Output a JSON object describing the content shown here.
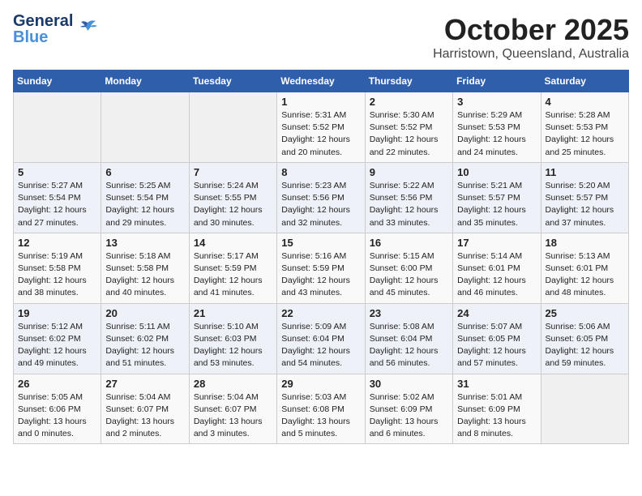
{
  "header": {
    "logo_line1": "General",
    "logo_line2": "Blue",
    "month": "October 2025",
    "location": "Harristown, Queensland, Australia"
  },
  "days_of_week": [
    "Sunday",
    "Monday",
    "Tuesday",
    "Wednesday",
    "Thursday",
    "Friday",
    "Saturday"
  ],
  "weeks": [
    [
      {
        "day": "",
        "info": ""
      },
      {
        "day": "",
        "info": ""
      },
      {
        "day": "",
        "info": ""
      },
      {
        "day": "1",
        "info": "Sunrise: 5:31 AM\nSunset: 5:52 PM\nDaylight: 12 hours and 20 minutes."
      },
      {
        "day": "2",
        "info": "Sunrise: 5:30 AM\nSunset: 5:52 PM\nDaylight: 12 hours and 22 minutes."
      },
      {
        "day": "3",
        "info": "Sunrise: 5:29 AM\nSunset: 5:53 PM\nDaylight: 12 hours and 24 minutes."
      },
      {
        "day": "4",
        "info": "Sunrise: 5:28 AM\nSunset: 5:53 PM\nDaylight: 12 hours and 25 minutes."
      }
    ],
    [
      {
        "day": "5",
        "info": "Sunrise: 5:27 AM\nSunset: 5:54 PM\nDaylight: 12 hours and 27 minutes."
      },
      {
        "day": "6",
        "info": "Sunrise: 5:25 AM\nSunset: 5:54 PM\nDaylight: 12 hours and 29 minutes."
      },
      {
        "day": "7",
        "info": "Sunrise: 5:24 AM\nSunset: 5:55 PM\nDaylight: 12 hours and 30 minutes."
      },
      {
        "day": "8",
        "info": "Sunrise: 5:23 AM\nSunset: 5:56 PM\nDaylight: 12 hours and 32 minutes."
      },
      {
        "day": "9",
        "info": "Sunrise: 5:22 AM\nSunset: 5:56 PM\nDaylight: 12 hours and 33 minutes."
      },
      {
        "day": "10",
        "info": "Sunrise: 5:21 AM\nSunset: 5:57 PM\nDaylight: 12 hours and 35 minutes."
      },
      {
        "day": "11",
        "info": "Sunrise: 5:20 AM\nSunset: 5:57 PM\nDaylight: 12 hours and 37 minutes."
      }
    ],
    [
      {
        "day": "12",
        "info": "Sunrise: 5:19 AM\nSunset: 5:58 PM\nDaylight: 12 hours and 38 minutes."
      },
      {
        "day": "13",
        "info": "Sunrise: 5:18 AM\nSunset: 5:58 PM\nDaylight: 12 hours and 40 minutes."
      },
      {
        "day": "14",
        "info": "Sunrise: 5:17 AM\nSunset: 5:59 PM\nDaylight: 12 hours and 41 minutes."
      },
      {
        "day": "15",
        "info": "Sunrise: 5:16 AM\nSunset: 5:59 PM\nDaylight: 12 hours and 43 minutes."
      },
      {
        "day": "16",
        "info": "Sunrise: 5:15 AM\nSunset: 6:00 PM\nDaylight: 12 hours and 45 minutes."
      },
      {
        "day": "17",
        "info": "Sunrise: 5:14 AM\nSunset: 6:01 PM\nDaylight: 12 hours and 46 minutes."
      },
      {
        "day": "18",
        "info": "Sunrise: 5:13 AM\nSunset: 6:01 PM\nDaylight: 12 hours and 48 minutes."
      }
    ],
    [
      {
        "day": "19",
        "info": "Sunrise: 5:12 AM\nSunset: 6:02 PM\nDaylight: 12 hours and 49 minutes."
      },
      {
        "day": "20",
        "info": "Sunrise: 5:11 AM\nSunset: 6:02 PM\nDaylight: 12 hours and 51 minutes."
      },
      {
        "day": "21",
        "info": "Sunrise: 5:10 AM\nSunset: 6:03 PM\nDaylight: 12 hours and 53 minutes."
      },
      {
        "day": "22",
        "info": "Sunrise: 5:09 AM\nSunset: 6:04 PM\nDaylight: 12 hours and 54 minutes."
      },
      {
        "day": "23",
        "info": "Sunrise: 5:08 AM\nSunset: 6:04 PM\nDaylight: 12 hours and 56 minutes."
      },
      {
        "day": "24",
        "info": "Sunrise: 5:07 AM\nSunset: 6:05 PM\nDaylight: 12 hours and 57 minutes."
      },
      {
        "day": "25",
        "info": "Sunrise: 5:06 AM\nSunset: 6:05 PM\nDaylight: 12 hours and 59 minutes."
      }
    ],
    [
      {
        "day": "26",
        "info": "Sunrise: 5:05 AM\nSunset: 6:06 PM\nDaylight: 13 hours and 0 minutes."
      },
      {
        "day": "27",
        "info": "Sunrise: 5:04 AM\nSunset: 6:07 PM\nDaylight: 13 hours and 2 minutes."
      },
      {
        "day": "28",
        "info": "Sunrise: 5:04 AM\nSunset: 6:07 PM\nDaylight: 13 hours and 3 minutes."
      },
      {
        "day": "29",
        "info": "Sunrise: 5:03 AM\nSunset: 6:08 PM\nDaylight: 13 hours and 5 minutes."
      },
      {
        "day": "30",
        "info": "Sunrise: 5:02 AM\nSunset: 6:09 PM\nDaylight: 13 hours and 6 minutes."
      },
      {
        "day": "31",
        "info": "Sunrise: 5:01 AM\nSunset: 6:09 PM\nDaylight: 13 hours and 8 minutes."
      },
      {
        "day": "",
        "info": ""
      }
    ]
  ]
}
